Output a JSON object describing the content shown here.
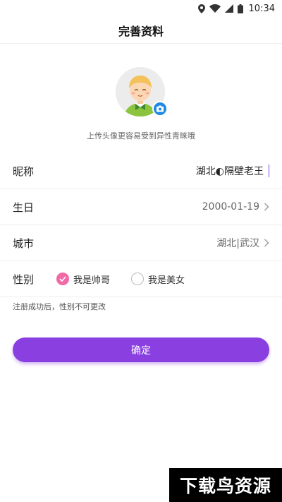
{
  "status_bar": {
    "time": "10:34",
    "icons": [
      "location-icon",
      "wifi-icon",
      "signal-icon",
      "battery-icon"
    ]
  },
  "header": {
    "title": "完善资料"
  },
  "avatar": {
    "hint": "上传头像更容易受到异性青睐哦",
    "badge_icon": "camera-icon"
  },
  "form": {
    "nickname": {
      "label": "昵称",
      "value": "湖北◐隔壁老王"
    },
    "birthday": {
      "label": "生日",
      "value": "2000-01-19"
    },
    "city": {
      "label": "城市",
      "value": "湖北|武汉"
    },
    "gender": {
      "label": "性别",
      "options": [
        {
          "label": "我是帅哥",
          "checked": true
        },
        {
          "label": "我是美女",
          "checked": false
        }
      ]
    },
    "note": "注册成功后，性别不可更改"
  },
  "confirm_button": {
    "label": "确定"
  },
  "watermark": {
    "text": "下载鸟资源"
  },
  "colors": {
    "accent": "#8a3fe0",
    "radio_checked": "#f06aa6",
    "badge": "#1e88e5"
  }
}
